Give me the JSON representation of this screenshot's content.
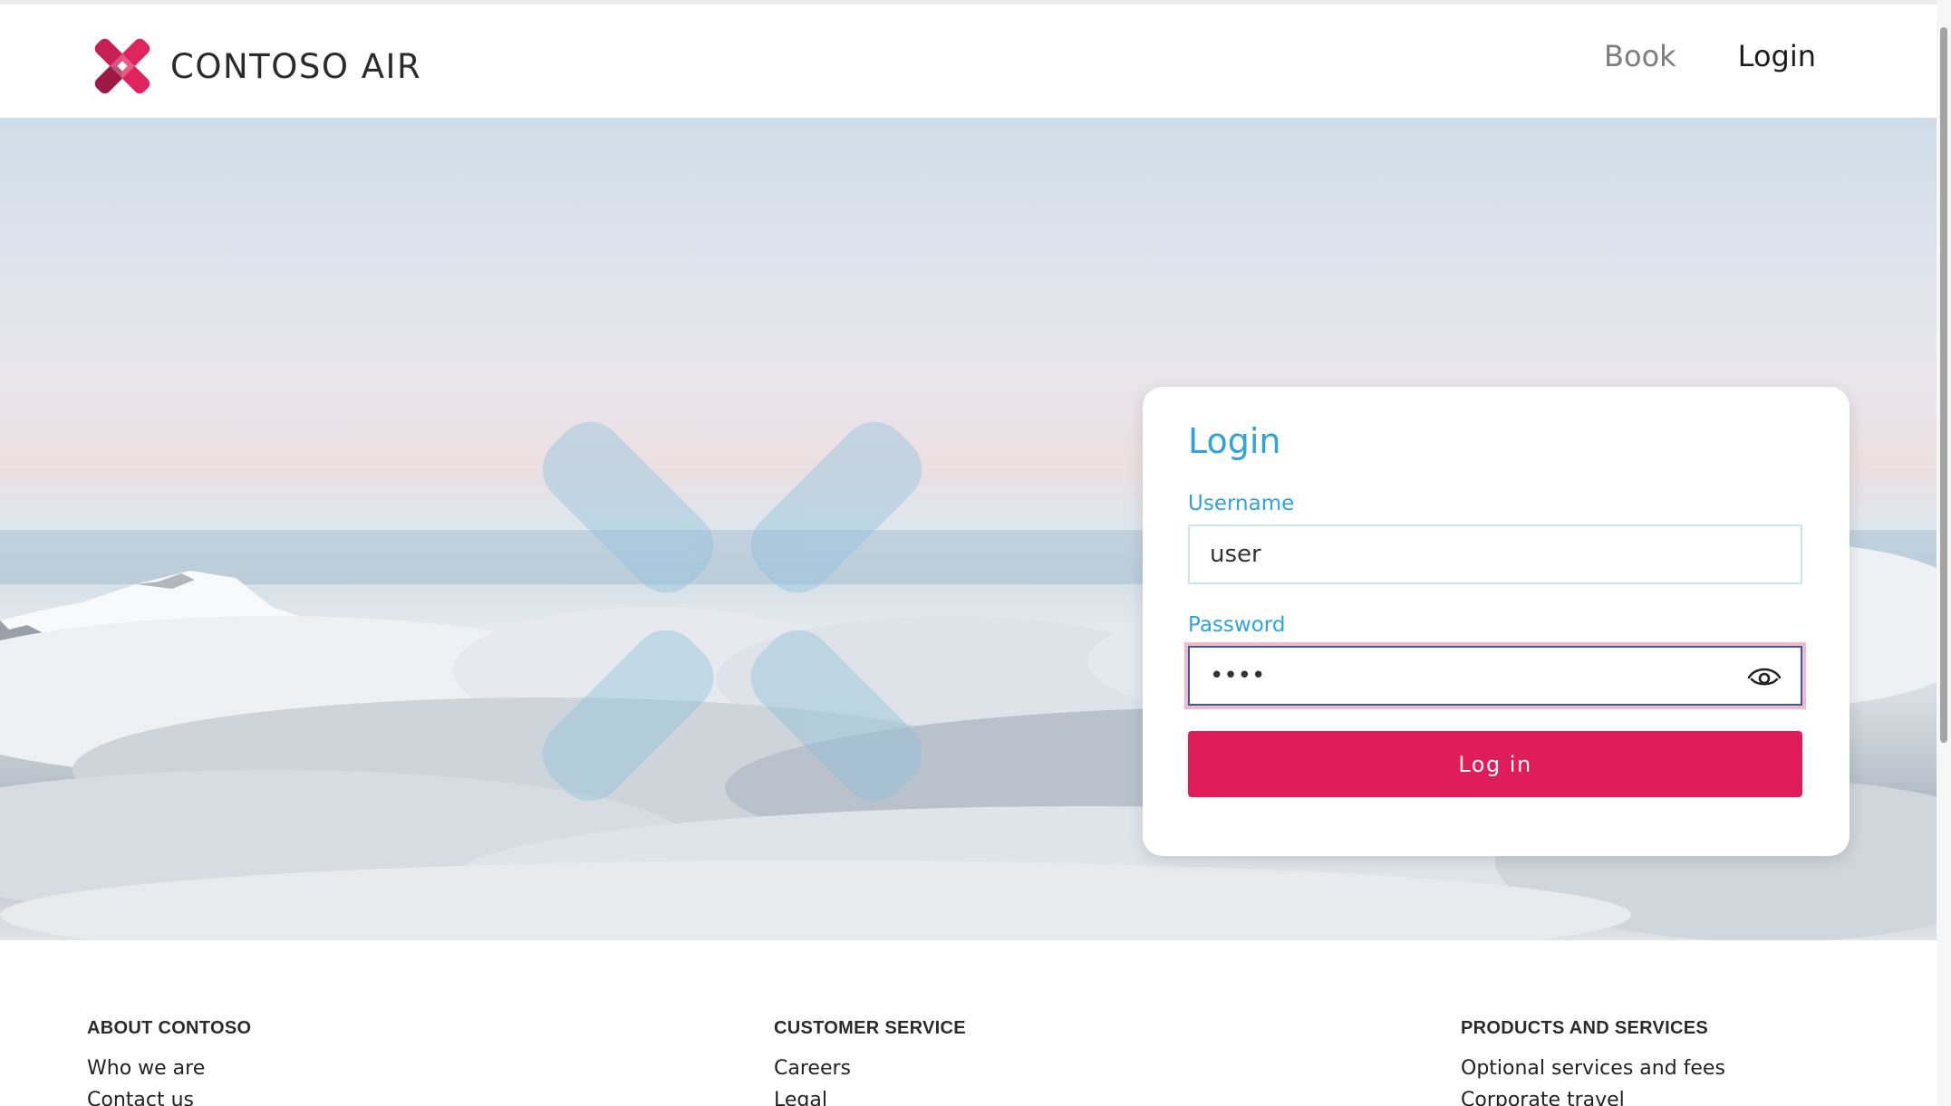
{
  "header": {
    "brand_name": "CONTOSO AIR",
    "nav": [
      {
        "label": "Book",
        "active": false
      },
      {
        "label": "Login",
        "active": true
      }
    ]
  },
  "login_card": {
    "title": "Login",
    "username_label": "Username",
    "username_value": "user",
    "password_label": "Password",
    "password_value": "••••",
    "password_toggle_icon": "eye-icon",
    "submit_label": "Log in"
  },
  "footer": {
    "columns": [
      {
        "heading": "ABOUT CONTOSO",
        "links": [
          "Who we are",
          "Contact us"
        ]
      },
      {
        "heading": "CUSTOMER SERVICE",
        "links": [
          "Careers",
          "Legal"
        ]
      },
      {
        "heading": "PRODUCTS AND SERVICES",
        "links": [
          "Optional services and fees",
          "Corporate travel"
        ]
      }
    ]
  },
  "colors": {
    "accent_blue": "#2fa3dc",
    "brand_pink": "#de1d5a",
    "focus_ring": "#f3b8cb"
  }
}
